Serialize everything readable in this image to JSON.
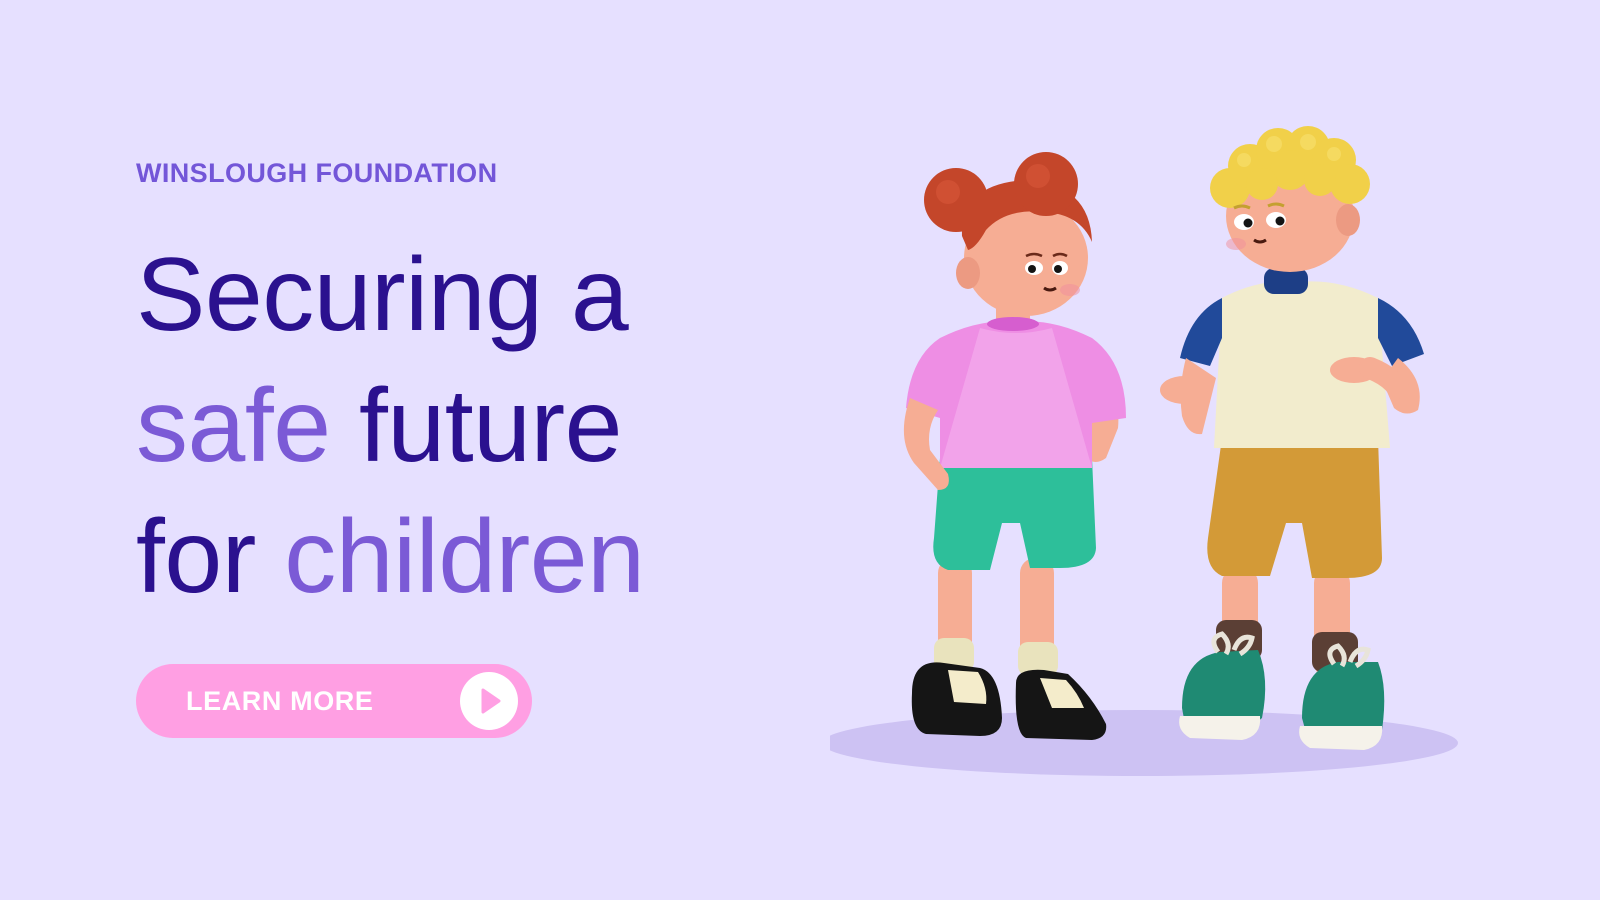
{
  "brand": {
    "name": "WINSLOUGH FOUNDATION"
  },
  "headline": {
    "line1": "Securing a",
    "line2_accent": "safe",
    "line2_rest": " future",
    "line3_lead": "for ",
    "line3_accent": "children"
  },
  "cta": {
    "label": "LEARN MORE",
    "icon": "play-icon"
  },
  "illustration": {
    "subject": "two-children-figures"
  },
  "colors": {
    "background": "#e6e0ff",
    "headline": "#2b118f",
    "accent": "#7b5ad6",
    "brand": "#7356d8",
    "button": "#ff9fe3"
  }
}
